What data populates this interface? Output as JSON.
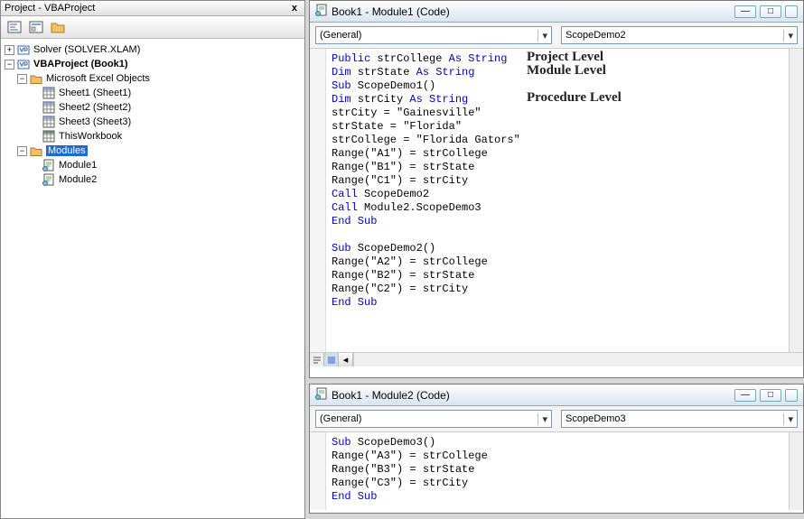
{
  "projectPanel": {
    "title": "Project - VBAProject",
    "close": "x",
    "tree": {
      "solver": "Solver (SOLVER.XLAM)",
      "vbaproject": "VBAProject (Book1)",
      "excelObjects": "Microsoft Excel Objects",
      "sheet1": "Sheet1 (Sheet1)",
      "sheet2": "Sheet2 (Sheet2)",
      "sheet3": "Sheet3 (Sheet3)",
      "thisWorkbook": "ThisWorkbook",
      "modules": "Modules",
      "module1": "Module1",
      "module2": "Module2"
    }
  },
  "window1": {
    "title": "Book1 - Module1 (Code)",
    "ddObject": "(General)",
    "ddProc": "ScopeDemo2",
    "scopeLabels": {
      "project": "Project Level",
      "module": "Module Level",
      "procedure": "Procedure Level"
    },
    "code": {
      "l1a": "Public",
      "l1b": " strCollege ",
      "l1c": "As String",
      "l2a": "Dim",
      "l2b": " strState ",
      "l2c": "As String",
      "l3a": "Sub",
      "l3b": " ScopeDemo1()",
      "l4a": "Dim",
      "l4b": " strCity ",
      "l4c": "As String",
      "l5": "strCity = \"Gainesville\"",
      "l6": "strState = \"Florida\"",
      "l7": "strCollege = \"Florida Gators\"",
      "l8": "Range(\"A1\") = strCollege",
      "l9": "Range(\"B1\") = strState",
      "l10": "Range(\"C1\") = strCity",
      "l11a": "Call",
      "l11b": " ScopeDemo2",
      "l12a": "Call",
      "l12b": " Module2.ScopeDemo3",
      "l13a": "End Sub",
      "l14": "",
      "l15a": "Sub",
      "l15b": " ScopeDemo2()",
      "l16": "Range(\"A2\") = strCollege",
      "l17": "Range(\"B2\") = strState",
      "l18": "Range(\"C2\") = strCity",
      "l19a": "End Sub"
    }
  },
  "window2": {
    "title": "Book1 - Module2 (Code)",
    "ddObject": "(General)",
    "ddProc": "ScopeDemo3",
    "code": {
      "l1a": "Sub",
      "l1b": " ScopeDemo3()",
      "l2": "Range(\"A3\") = strCollege",
      "l3": "Range(\"B3\") = strState",
      "l4": "Range(\"C3\") = strCity",
      "l5a": "End Sub"
    }
  }
}
